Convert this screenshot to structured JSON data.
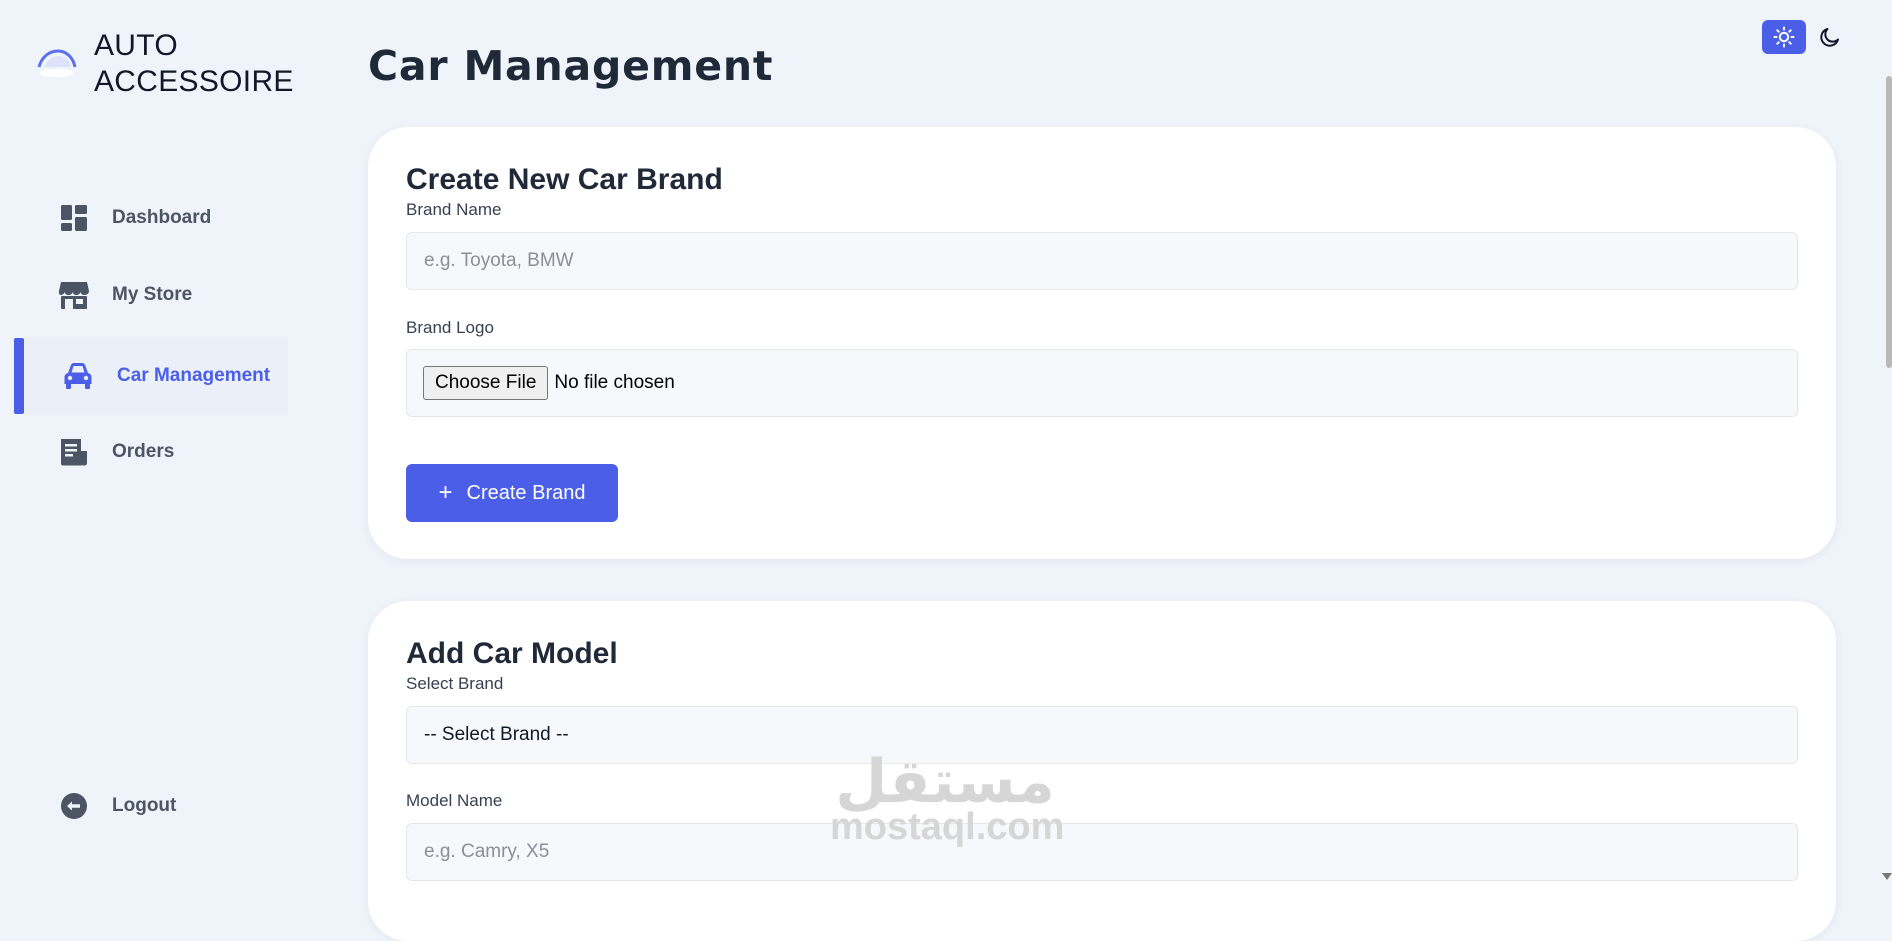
{
  "app": {
    "name_line1": "AUTO",
    "name_line2": "ACCESSOIRE",
    "accent": "#4a5ee8"
  },
  "sidebar": {
    "items": [
      {
        "label": "Dashboard",
        "icon": "dashboard-icon",
        "active": false
      },
      {
        "label": "My Store",
        "icon": "store-icon",
        "active": false
      },
      {
        "label": "Car Management",
        "icon": "car-icon",
        "active": true
      },
      {
        "label": "Orders",
        "icon": "orders-icon",
        "active": false
      }
    ],
    "logout_label": "Logout"
  },
  "theme": {
    "light_icon": "sun-icon",
    "dark_icon": "moon-icon",
    "selected": "light"
  },
  "main": {
    "title": "Car Management",
    "brand_form": {
      "title": "Create New Car Brand",
      "name_label": "Brand Name",
      "name_placeholder": "e.g. Toyota, BMW",
      "logo_label": "Brand Logo",
      "choose_file_label": "Choose File",
      "file_status": "No file chosen",
      "submit_label": "Create Brand"
    },
    "model_form": {
      "title": "Add Car Model",
      "brand_label": "Select Brand",
      "brand_selected": "-- Select Brand --",
      "model_label": "Model Name",
      "model_placeholder": "e.g. Camry, X5"
    }
  },
  "watermark": {
    "arabic": "مستقل",
    "latin": "mostaql.com"
  }
}
